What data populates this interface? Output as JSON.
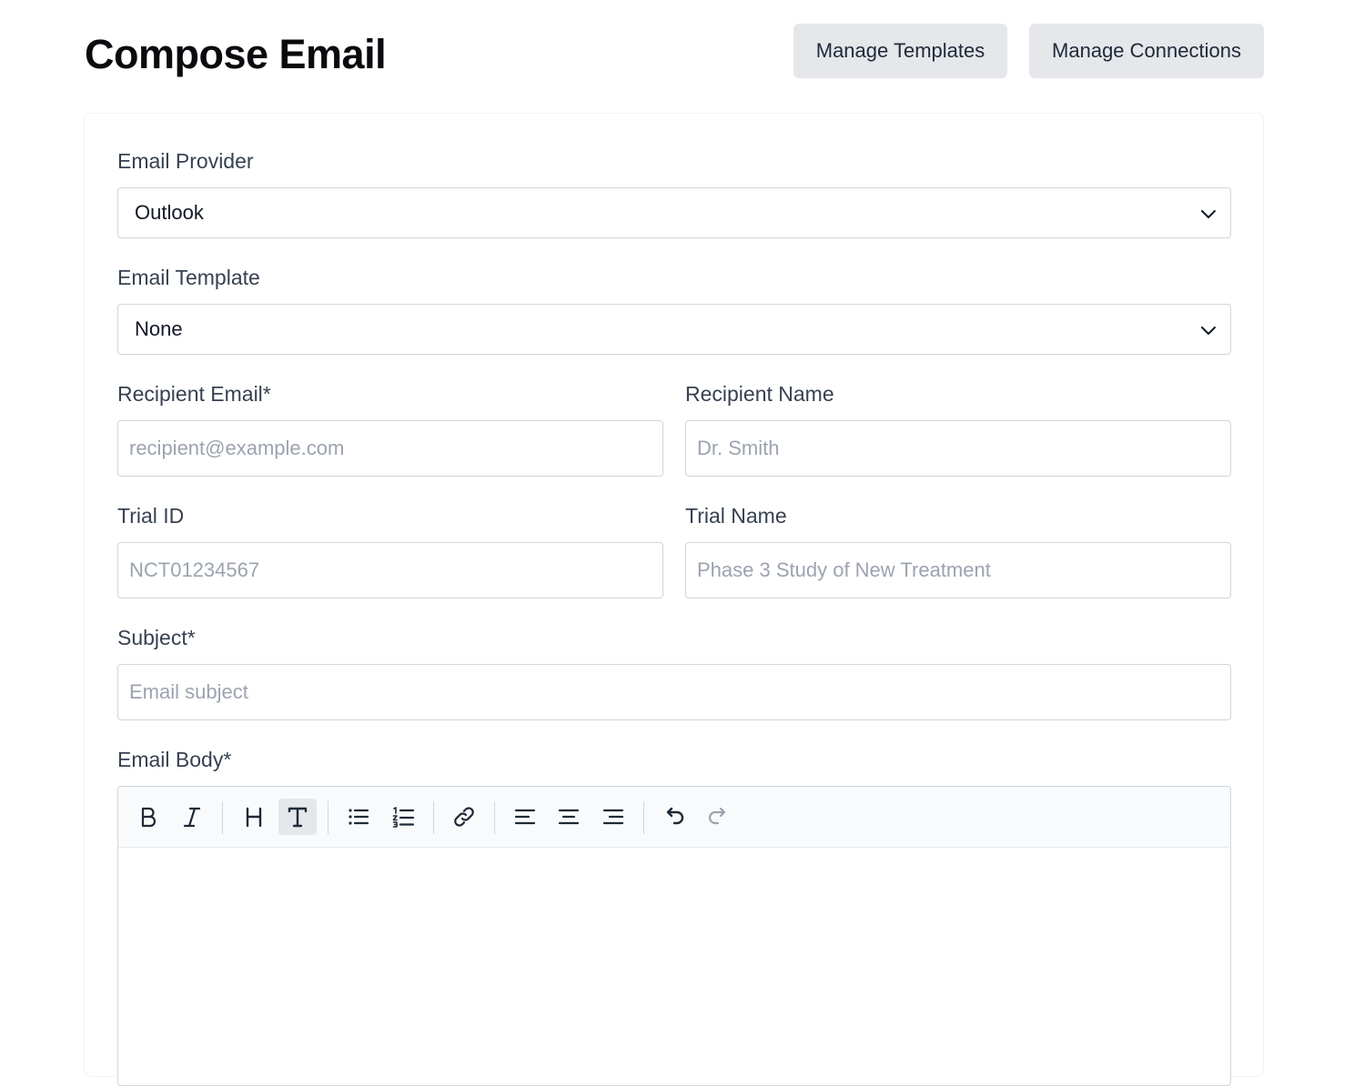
{
  "header": {
    "title": "Compose Email",
    "manage_templates_label": "Manage Templates",
    "manage_connections_label": "Manage Connections"
  },
  "form": {
    "provider": {
      "label": "Email Provider",
      "value": "Outlook"
    },
    "template": {
      "label": "Email Template",
      "value": "None"
    },
    "recipient_email": {
      "label": "Recipient Email*",
      "placeholder": "recipient@example.com"
    },
    "recipient_name": {
      "label": "Recipient Name",
      "placeholder": "Dr. Smith"
    },
    "trial_id": {
      "label": "Trial ID",
      "placeholder": "NCT01234567"
    },
    "trial_name": {
      "label": "Trial Name",
      "placeholder": "Phase 3 Study of New Treatment"
    },
    "subject": {
      "label": "Subject*",
      "placeholder": "Email subject"
    },
    "body": {
      "label": "Email Body*"
    }
  },
  "toolbar": {
    "buttons": [
      {
        "icon": "bold-icon",
        "active": false
      },
      {
        "icon": "italic-icon",
        "active": false
      },
      {
        "icon": "heading-icon",
        "active": false
      },
      {
        "icon": "paragraph-text-icon",
        "active": true
      },
      {
        "icon": "bullet-list-icon",
        "active": false
      },
      {
        "icon": "ordered-list-icon",
        "active": false
      },
      {
        "icon": "link-icon",
        "active": false
      },
      {
        "icon": "align-left-icon",
        "active": false
      },
      {
        "icon": "align-center-icon",
        "active": false
      },
      {
        "icon": "align-right-icon",
        "active": false
      },
      {
        "icon": "undo-icon",
        "active": false
      },
      {
        "icon": "redo-icon",
        "active": false
      }
    ]
  }
}
